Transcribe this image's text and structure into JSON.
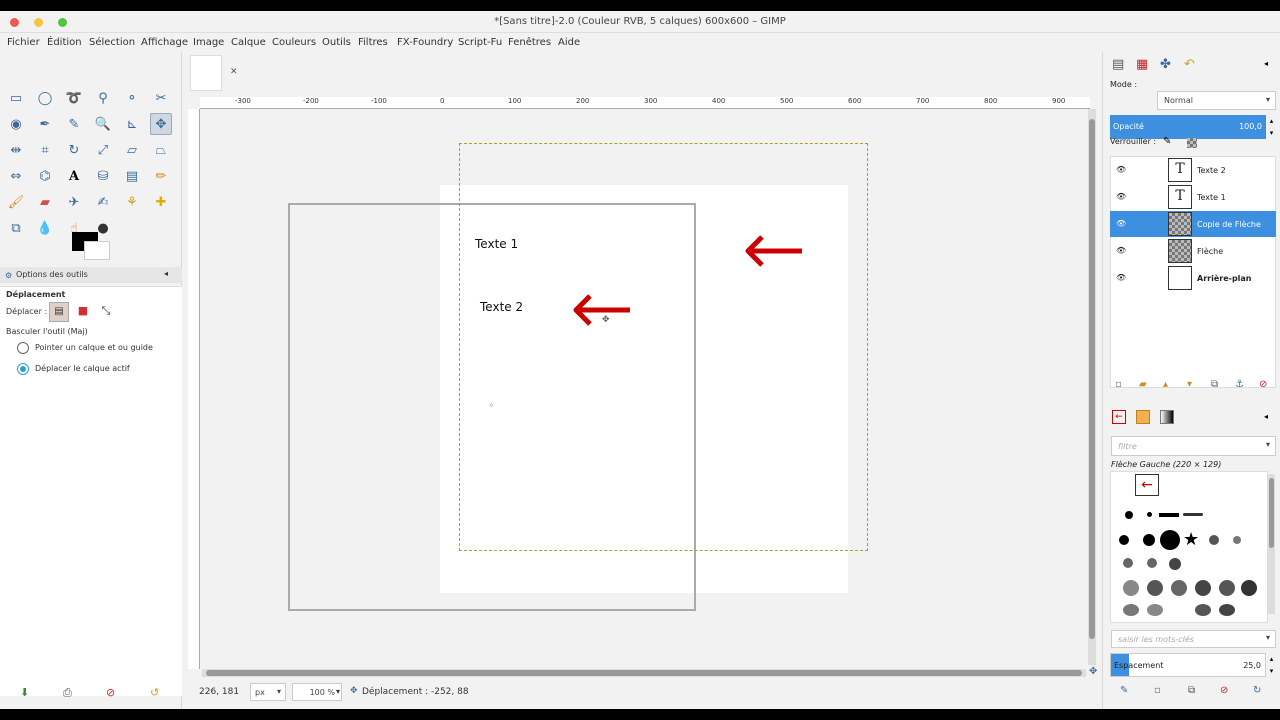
{
  "window": {
    "title": "*[Sans titre]-2.0 (Couleur RVB, 5 calques) 600x600 – GIMP"
  },
  "menu": [
    "Fichier",
    "Édition",
    "Sélection",
    "Affichage",
    "Image",
    "Calque",
    "Couleurs",
    "Outils",
    "Filtres",
    "FX-Foundry",
    "Script-Fu",
    "Fenêtres",
    "Aide"
  ],
  "tool_options": {
    "tab_title": "Options des outils",
    "tool_name": "Déplacement",
    "move_label": "Déplacer :",
    "toggle_label": "Basculer l'outil  (Maj)",
    "option1": "Pointer un calque et ou guide",
    "option2": "Déplacer le calque actif"
  },
  "ruler": {
    "h_ticks": [
      "-300",
      "-200",
      "-100",
      "0",
      "100",
      "200",
      "300",
      "400",
      "500",
      "600",
      "700",
      "800",
      "900"
    ]
  },
  "canvas": {
    "text1": "Texte 1",
    "text2": "Texte 2"
  },
  "status": {
    "coords": "226, 181",
    "unit": "px",
    "zoom": "100 %",
    "message": "Déplacement : -252, 88"
  },
  "layers_panel": {
    "mode_label": "Mode :",
    "mode_value": "Normal",
    "opacity_label": "Opacité",
    "opacity_value": "100,0",
    "lock_label": "Verrouiller :",
    "layers": [
      "Texte 2",
      "Texte 1",
      "Copie de Flèche",
      "Flèche",
      "Arrière-plan"
    ]
  },
  "brushes_panel": {
    "filter_placeholder": "filtre",
    "brush_name": "Flèche Gauche (220 × 129)",
    "tags_placeholder": "saisir les mots-clés",
    "spacing_label": "Espacement",
    "spacing_value": "25,0"
  },
  "colors": {
    "accent": "#3d8fe0",
    "arrow": "#cc0000"
  }
}
